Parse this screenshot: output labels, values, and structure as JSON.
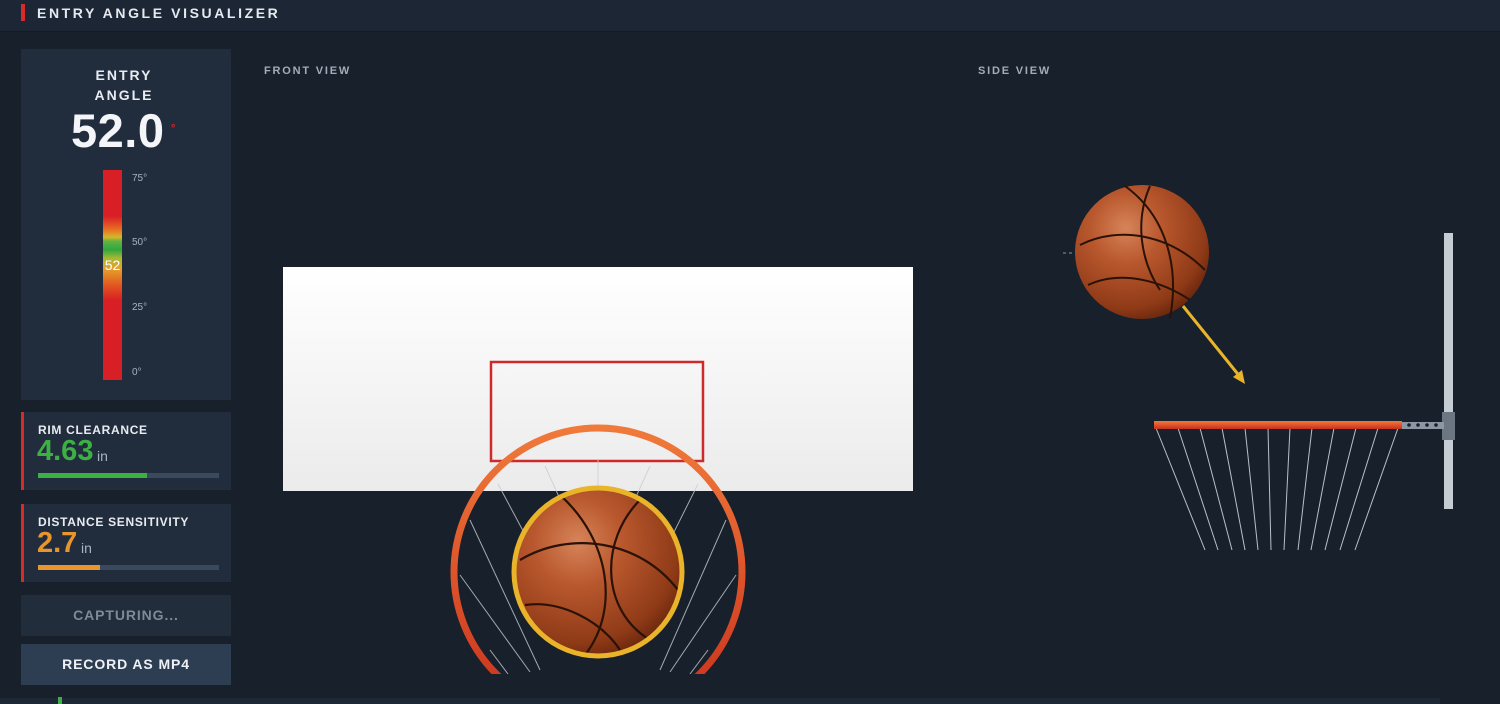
{
  "app": {
    "title": "ENTRY ANGLE VISUALIZER"
  },
  "entry_angle": {
    "label_line1": "ENTRY",
    "label_line2": "ANGLE",
    "value": "52.0",
    "degree_symbol": "°",
    "gauge_marker": "52",
    "gauge_ticks": [
      "75°",
      "50°",
      "25°",
      "0°"
    ],
    "gauge_range": [
      0,
      75
    ]
  },
  "rim_clearance": {
    "label": "RIM CLEARANCE",
    "value": "4.63",
    "unit": "in",
    "fill_fraction": 0.6,
    "color": "#3cb043"
  },
  "distance_sensitivity": {
    "label": "DISTANCE SENSITIVITY",
    "value": "2.7",
    "unit": "in",
    "fill_fraction": 0.34,
    "color": "#e8952e"
  },
  "buttons": {
    "capture_label": "CAPTURING...",
    "record_label": "RECORD AS MP4"
  },
  "views": {
    "front_label": "FRONT VIEW",
    "side_label": "SIDE VIEW"
  },
  "colors": {
    "accent_red": "#d92a2a",
    "ring_yellow": "#e9b42a",
    "trajectory": "#e9b42a",
    "ball": "#b5522a"
  }
}
